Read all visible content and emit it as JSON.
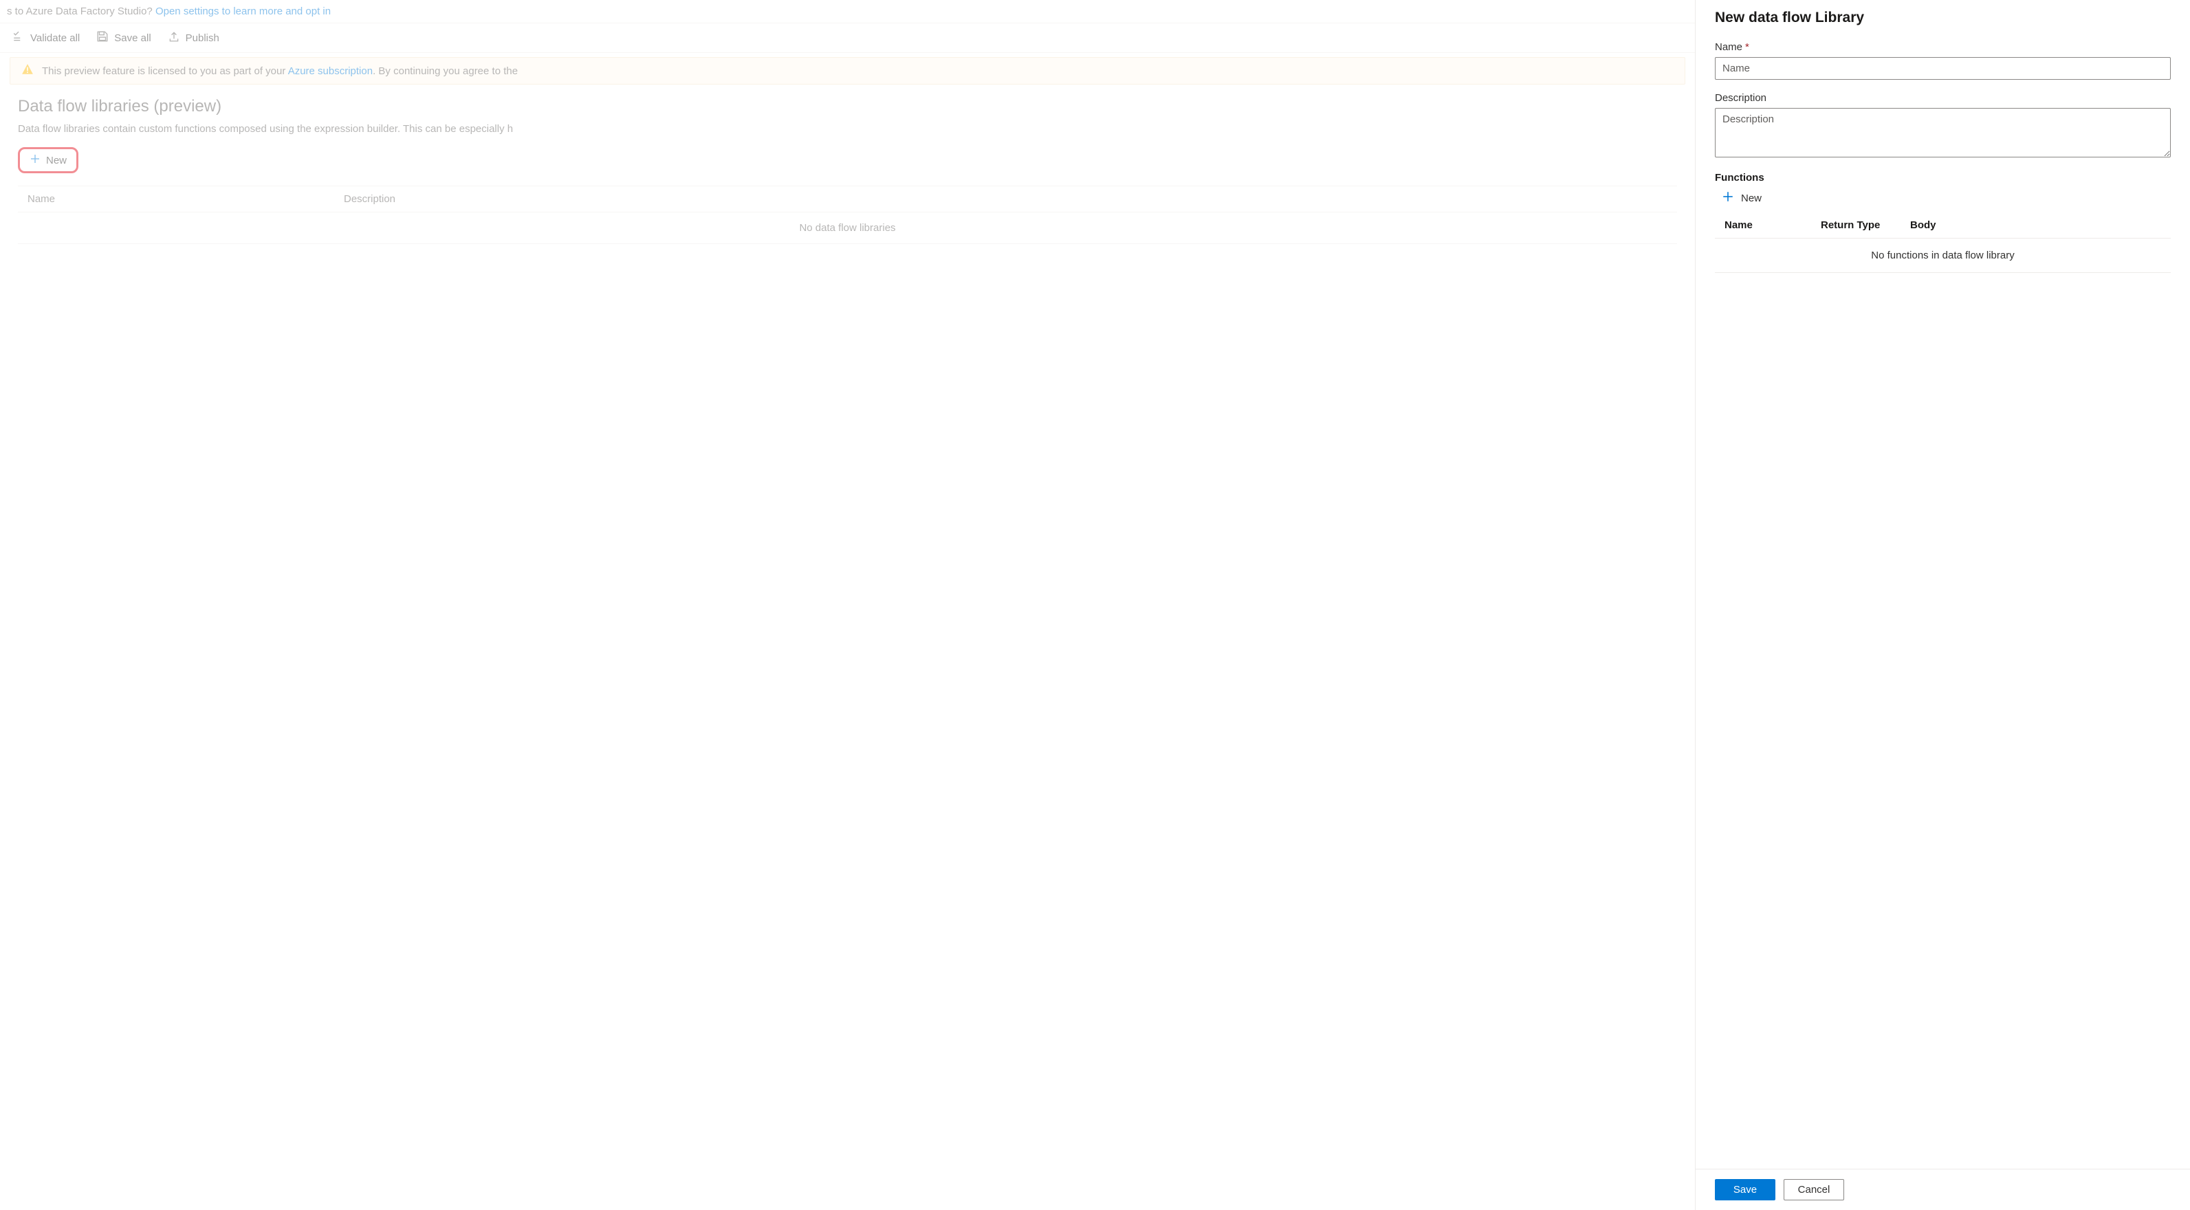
{
  "top_banner": {
    "prefix": "s to Azure Data Factory Studio? ",
    "link": "Open settings to learn more and opt in"
  },
  "toolbar": {
    "validate_all": "Validate all",
    "save_all": "Save all",
    "publish": "Publish"
  },
  "warning": {
    "prefix": "This preview feature is licensed to you as part of your ",
    "link": "Azure subscription",
    "suffix": ". By continuing you agree to the"
  },
  "page": {
    "title": "Data flow libraries (preview)",
    "description": "Data flow libraries contain custom functions composed using the expression builder. This can be especially h",
    "new_button": "New",
    "columns": {
      "name": "Name",
      "description": "Description"
    },
    "empty": "No data flow libraries"
  },
  "panel": {
    "title": "New data flow Library",
    "name_label": "Name",
    "name_placeholder": "Name",
    "description_label": "Description",
    "description_placeholder": "Description",
    "functions_label": "Functions",
    "functions_new": "New",
    "func_columns": {
      "name": "Name",
      "return_type": "Return Type",
      "body": "Body"
    },
    "func_empty": "No functions in data flow library",
    "save": "Save",
    "cancel": "Cancel"
  }
}
